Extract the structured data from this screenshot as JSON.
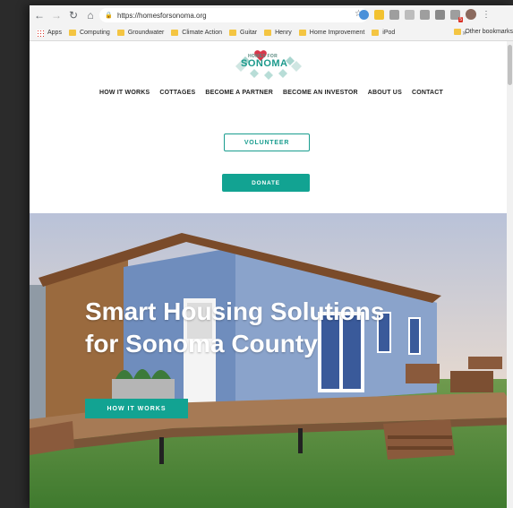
{
  "browser": {
    "url": "https://homesforsonoma.org",
    "bookmarks": [
      "Computing",
      "Groundwater",
      "Climate Action",
      "Guitar",
      "Henry",
      "Home Improvement",
      "iPod"
    ],
    "apps_label": "Apps",
    "more_label": "»",
    "other_bookmarks": "Other bookmarks",
    "ext_badge": "5"
  },
  "logo": {
    "line1": "HOMES FOR",
    "line2": "SONOMA"
  },
  "nav": [
    "HOW IT WORKS",
    "COTTAGES",
    "BECOME A PARTNER",
    "BECOME AN INVESTOR",
    "ABOUT US",
    "CONTACT"
  ],
  "buttons": {
    "volunteer": "VOLUNTEER",
    "donate": "DONATE"
  },
  "hero": {
    "title_line1": "Smart Housing Solutions",
    "title_line2": "for Sonoma County",
    "cta": "HOW IT WORKS"
  },
  "colors": {
    "brand_teal": "#12a392",
    "heart_red": "#d9364a"
  }
}
